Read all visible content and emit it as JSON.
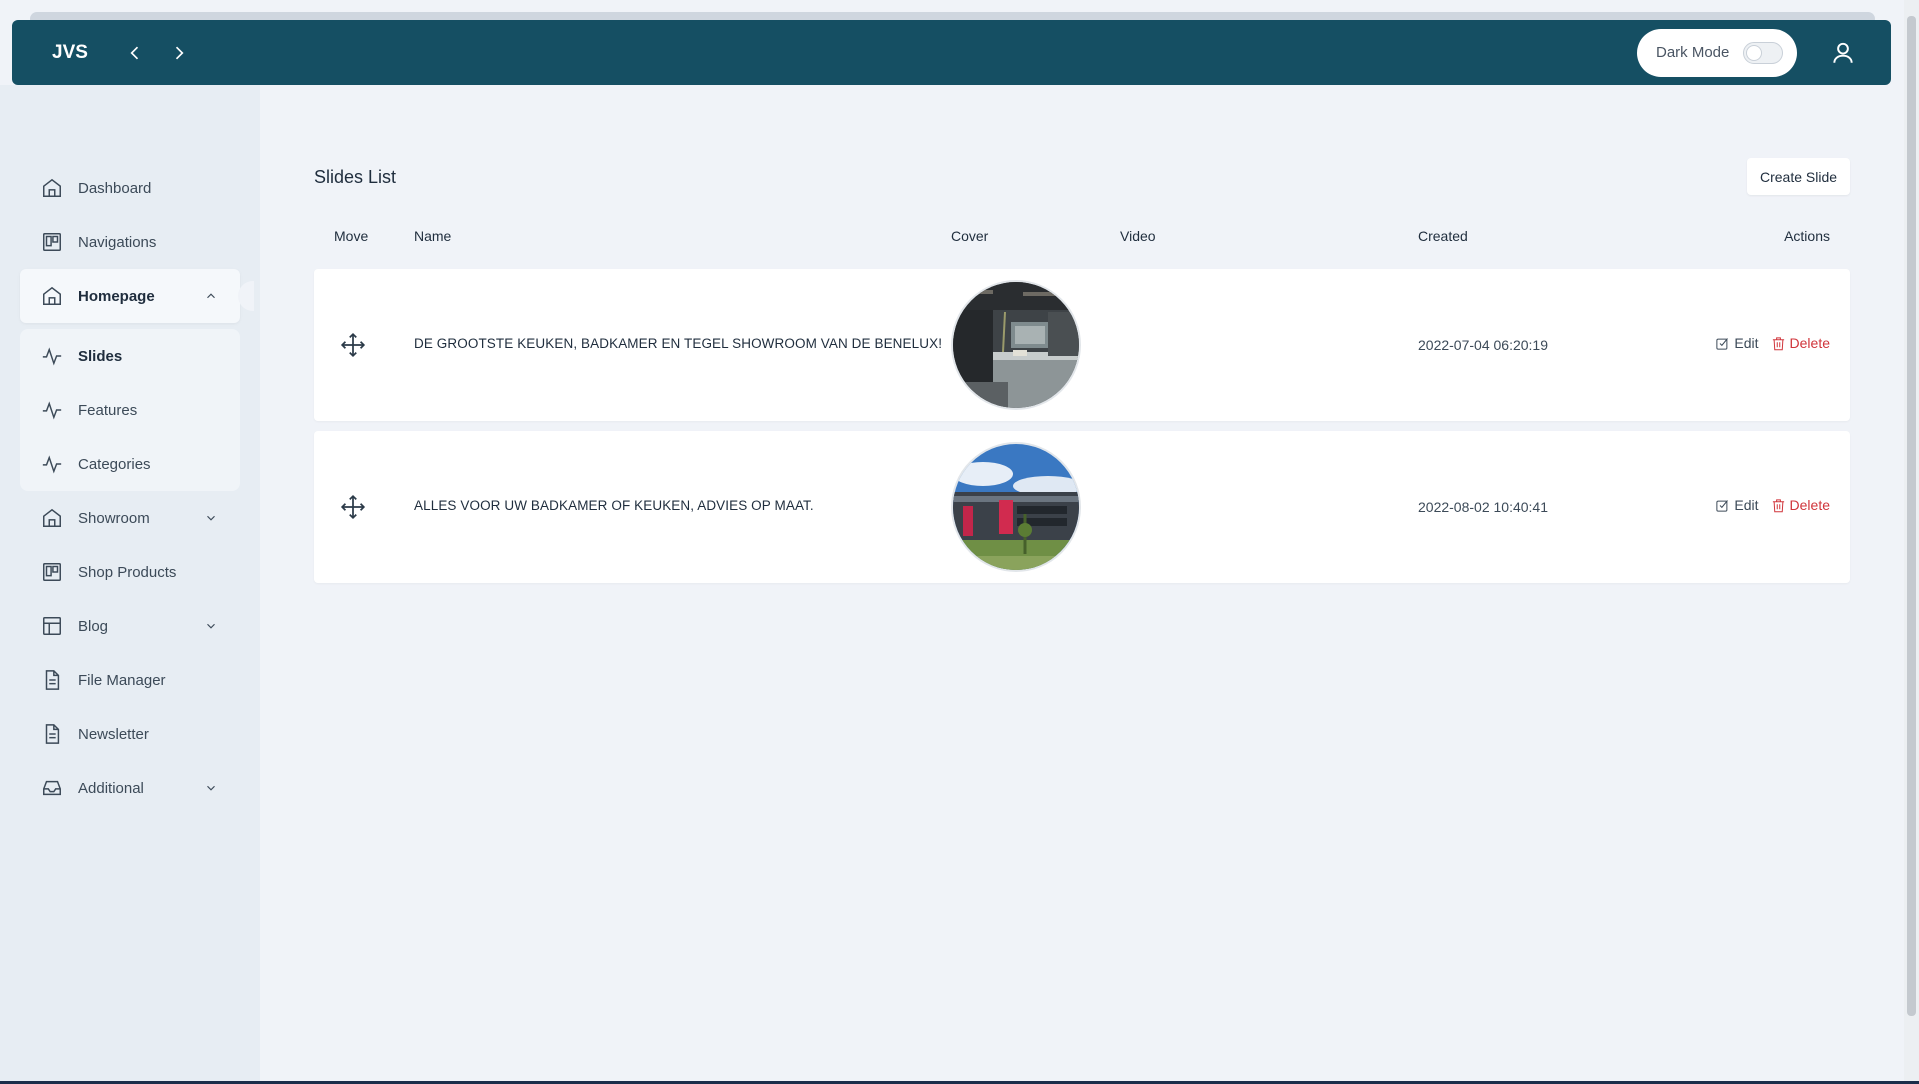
{
  "app": {
    "brand": "JVS",
    "dark_mode_label": "Dark Mode",
    "dark_mode_on": false
  },
  "sidebar": {
    "items": [
      {
        "label": "Dashboard",
        "icon": "home-icon"
      },
      {
        "label": "Navigations",
        "icon": "board-icon"
      },
      {
        "label": "Homepage",
        "icon": "home-icon",
        "expanded": true,
        "children": [
          {
            "label": "Slides",
            "icon": "activity-icon"
          },
          {
            "label": "Features",
            "icon": "activity-icon"
          },
          {
            "label": "Categories",
            "icon": "activity-icon"
          }
        ]
      },
      {
        "label": "Showroom",
        "icon": "home-icon",
        "expandable": true
      },
      {
        "label": "Shop Products",
        "icon": "board-icon"
      },
      {
        "label": "Blog",
        "icon": "layout-icon",
        "expandable": true
      },
      {
        "label": "File Manager",
        "icon": "file-icon"
      },
      {
        "label": "Newsletter",
        "icon": "file-icon"
      },
      {
        "label": "Additional",
        "icon": "inbox-icon",
        "expandable": true
      }
    ]
  },
  "page": {
    "title": "Slides List",
    "create_button": "Create Slide",
    "columns": {
      "move": "Move",
      "name": "Name",
      "cover": "Cover",
      "video": "Video",
      "created": "Created",
      "actions": "Actions"
    },
    "rows": [
      {
        "name": "DE GROOTSTE KEUKEN, BADKAMER EN TEGEL SHOWROOM VAN DE BENELUX!",
        "video": "",
        "created": "2022-07-04 06:20:19",
        "edit": "Edit",
        "delete": "Delete"
      },
      {
        "name": "ALLES VOOR UW BADKAMER OF KEUKEN, ADVIES OP MAAT.",
        "video": "",
        "created": "2022-08-02 10:40:41",
        "edit": "Edit",
        "delete": "Delete"
      }
    ]
  },
  "colors": {
    "topbar": "#154f63",
    "delete": "#d0353b",
    "background": "#f0f3f8"
  }
}
